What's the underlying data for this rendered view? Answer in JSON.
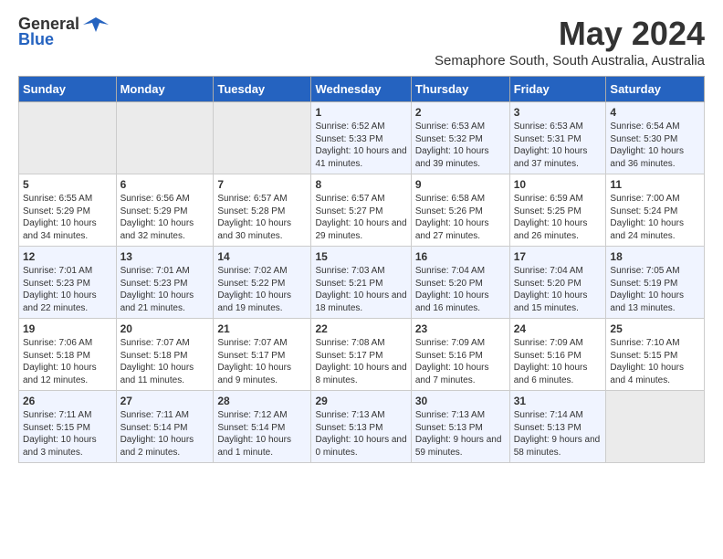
{
  "header": {
    "logo_general": "General",
    "logo_blue": "Blue",
    "month_title": "May 2024",
    "subtitle": "Semaphore South, South Australia, Australia"
  },
  "calendar": {
    "headers": [
      "Sunday",
      "Monday",
      "Tuesday",
      "Wednesday",
      "Thursday",
      "Friday",
      "Saturday"
    ],
    "rows": [
      [
        {
          "day": "",
          "empty": true
        },
        {
          "day": "",
          "empty": true
        },
        {
          "day": "",
          "empty": true
        },
        {
          "day": "1",
          "sunrise": "6:52 AM",
          "sunset": "5:33 PM",
          "daylight": "10 hours and 41 minutes."
        },
        {
          "day": "2",
          "sunrise": "6:53 AM",
          "sunset": "5:32 PM",
          "daylight": "10 hours and 39 minutes."
        },
        {
          "day": "3",
          "sunrise": "6:53 AM",
          "sunset": "5:31 PM",
          "daylight": "10 hours and 37 minutes."
        },
        {
          "day": "4",
          "sunrise": "6:54 AM",
          "sunset": "5:30 PM",
          "daylight": "10 hours and 36 minutes."
        }
      ],
      [
        {
          "day": "5",
          "sunrise": "6:55 AM",
          "sunset": "5:29 PM",
          "daylight": "10 hours and 34 minutes."
        },
        {
          "day": "6",
          "sunrise": "6:56 AM",
          "sunset": "5:29 PM",
          "daylight": "10 hours and 32 minutes."
        },
        {
          "day": "7",
          "sunrise": "6:57 AM",
          "sunset": "5:28 PM",
          "daylight": "10 hours and 30 minutes."
        },
        {
          "day": "8",
          "sunrise": "6:57 AM",
          "sunset": "5:27 PM",
          "daylight": "10 hours and 29 minutes."
        },
        {
          "day": "9",
          "sunrise": "6:58 AM",
          "sunset": "5:26 PM",
          "daylight": "10 hours and 27 minutes."
        },
        {
          "day": "10",
          "sunrise": "6:59 AM",
          "sunset": "5:25 PM",
          "daylight": "10 hours and 26 minutes."
        },
        {
          "day": "11",
          "sunrise": "7:00 AM",
          "sunset": "5:24 PM",
          "daylight": "10 hours and 24 minutes."
        }
      ],
      [
        {
          "day": "12",
          "sunrise": "7:01 AM",
          "sunset": "5:23 PM",
          "daylight": "10 hours and 22 minutes."
        },
        {
          "day": "13",
          "sunrise": "7:01 AM",
          "sunset": "5:23 PM",
          "daylight": "10 hours and 21 minutes."
        },
        {
          "day": "14",
          "sunrise": "7:02 AM",
          "sunset": "5:22 PM",
          "daylight": "10 hours and 19 minutes."
        },
        {
          "day": "15",
          "sunrise": "7:03 AM",
          "sunset": "5:21 PM",
          "daylight": "10 hours and 18 minutes."
        },
        {
          "day": "16",
          "sunrise": "7:04 AM",
          "sunset": "5:20 PM",
          "daylight": "10 hours and 16 minutes."
        },
        {
          "day": "17",
          "sunrise": "7:04 AM",
          "sunset": "5:20 PM",
          "daylight": "10 hours and 15 minutes."
        },
        {
          "day": "18",
          "sunrise": "7:05 AM",
          "sunset": "5:19 PM",
          "daylight": "10 hours and 13 minutes."
        }
      ],
      [
        {
          "day": "19",
          "sunrise": "7:06 AM",
          "sunset": "5:18 PM",
          "daylight": "10 hours and 12 minutes."
        },
        {
          "day": "20",
          "sunrise": "7:07 AM",
          "sunset": "5:18 PM",
          "daylight": "10 hours and 11 minutes."
        },
        {
          "day": "21",
          "sunrise": "7:07 AM",
          "sunset": "5:17 PM",
          "daylight": "10 hours and 9 minutes."
        },
        {
          "day": "22",
          "sunrise": "7:08 AM",
          "sunset": "5:17 PM",
          "daylight": "10 hours and 8 minutes."
        },
        {
          "day": "23",
          "sunrise": "7:09 AM",
          "sunset": "5:16 PM",
          "daylight": "10 hours and 7 minutes."
        },
        {
          "day": "24",
          "sunrise": "7:09 AM",
          "sunset": "5:16 PM",
          "daylight": "10 hours and 6 minutes."
        },
        {
          "day": "25",
          "sunrise": "7:10 AM",
          "sunset": "5:15 PM",
          "daylight": "10 hours and 4 minutes."
        }
      ],
      [
        {
          "day": "26",
          "sunrise": "7:11 AM",
          "sunset": "5:15 PM",
          "daylight": "10 hours and 3 minutes."
        },
        {
          "day": "27",
          "sunrise": "7:11 AM",
          "sunset": "5:14 PM",
          "daylight": "10 hours and 2 minutes."
        },
        {
          "day": "28",
          "sunrise": "7:12 AM",
          "sunset": "5:14 PM",
          "daylight": "10 hours and 1 minute."
        },
        {
          "day": "29",
          "sunrise": "7:13 AM",
          "sunset": "5:13 PM",
          "daylight": "10 hours and 0 minutes."
        },
        {
          "day": "30",
          "sunrise": "7:13 AM",
          "sunset": "5:13 PM",
          "daylight": "9 hours and 59 minutes."
        },
        {
          "day": "31",
          "sunrise": "7:14 AM",
          "sunset": "5:13 PM",
          "daylight": "9 hours and 58 minutes."
        },
        {
          "day": "",
          "empty": true
        }
      ]
    ]
  },
  "labels": {
    "sunrise_prefix": "Sunrise: ",
    "sunset_prefix": "Sunset: ",
    "daylight_prefix": "Daylight: "
  }
}
